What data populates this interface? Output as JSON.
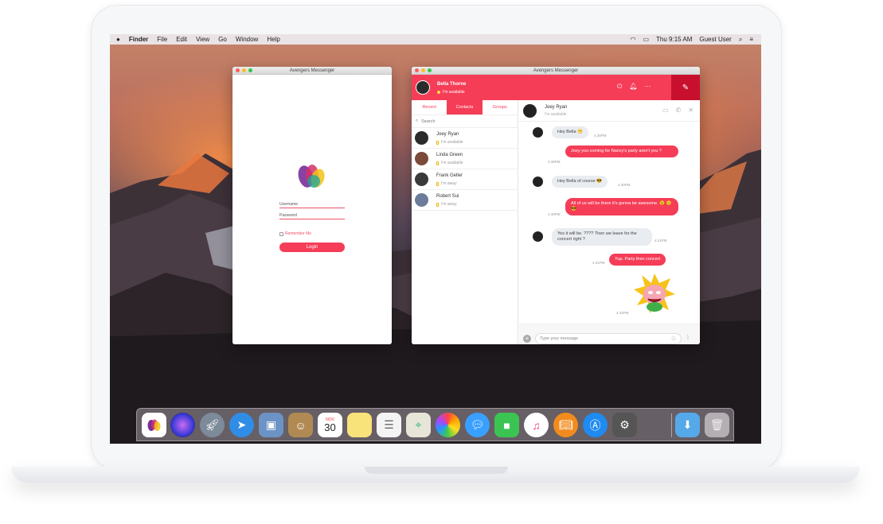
{
  "menubar": {
    "apple": "",
    "app": "Finder",
    "items": [
      "File",
      "Edit",
      "View",
      "Go",
      "Window",
      "Help"
    ],
    "clock": "Thu 9:15 AM",
    "user": "Guest User"
  },
  "login_window": {
    "title": "Avengers Messenger",
    "username_placeholder": "Username",
    "password_placeholder": "Password",
    "remember": "Remember Me",
    "login_button": "Login"
  },
  "messenger": {
    "title": "Avengers Messenger",
    "user_name": "Bella Thorne",
    "user_status": "I'm available",
    "tabs": [
      "Recent",
      "Contacts",
      "Groups"
    ],
    "search_label": "Search",
    "contacts": [
      {
        "name": "Joey Ryan",
        "status": "I'm available"
      },
      {
        "name": "Linda Green",
        "status": "I'm available"
      },
      {
        "name": "Frank Geller",
        "status": "I'm away"
      },
      {
        "name": "Robert Sui",
        "status": "I'm away"
      }
    ],
    "chat": {
      "name": "Joey Ryan",
      "status": "I'm available",
      "messages": [
        {
          "dir": "in",
          "text": "Hey Bella 😁",
          "time": "4:38PM"
        },
        {
          "dir": "out",
          "text": "Joey you coming for Nancy's party aren't you ?",
          "time": "4:38PM"
        },
        {
          "dir": "in",
          "text": "Hey Bella of course 😎",
          "time": "4:40PM"
        },
        {
          "dir": "out",
          "text": "All of us will be there it's gonna be awesome. 😉 😊 😎",
          "time": "4:40PM"
        },
        {
          "dir": "in",
          "text": "Yes it will be. ???? Then we leave for the concert right ?",
          "time": "4:41PM"
        },
        {
          "dir": "out",
          "text": "Yup. Party then concert",
          "time": "4:41PM"
        },
        {
          "dir": "out",
          "text": "",
          "time": "4:42PM"
        }
      ],
      "input_placeholder": "Type your message"
    }
  },
  "dock": {
    "icons": [
      "messenger-app",
      "siri",
      "launchpad",
      "safari",
      "preview",
      "contacts",
      "calendar",
      "notes",
      "reminders",
      "maps",
      "photos",
      "messages",
      "facetime",
      "itunes",
      "ibooks",
      "app-store",
      "system-preferences",
      "downloads",
      "trash"
    ],
    "calendar_month": "NOV",
    "calendar_day": "30"
  },
  "colors": {
    "accent": "#f53d57",
    "accent_dark": "#c8102e"
  }
}
